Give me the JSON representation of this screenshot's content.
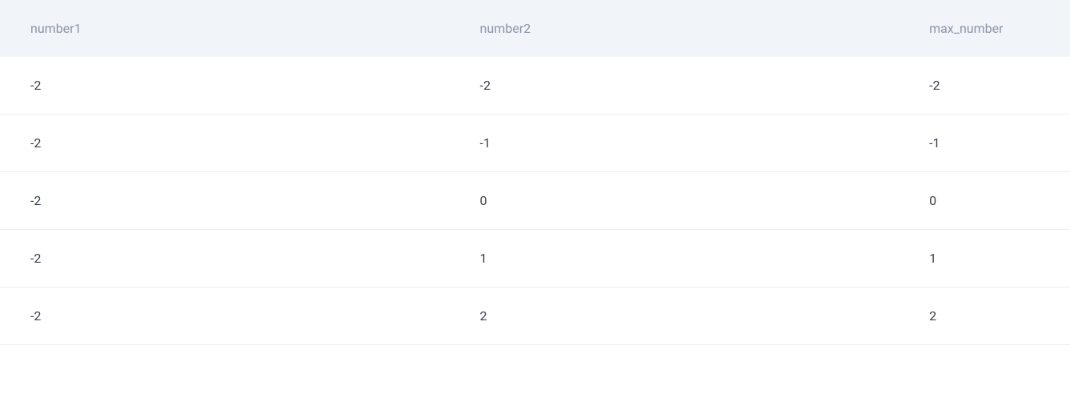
{
  "table": {
    "headers": [
      "number1",
      "number2",
      "max_number"
    ],
    "rows": [
      [
        "-2",
        "-2",
        "-2"
      ],
      [
        "-2",
        "-1",
        "-1"
      ],
      [
        "-2",
        "0",
        "0"
      ],
      [
        "-2",
        "1",
        "1"
      ],
      [
        "-2",
        "2",
        "2"
      ]
    ]
  }
}
